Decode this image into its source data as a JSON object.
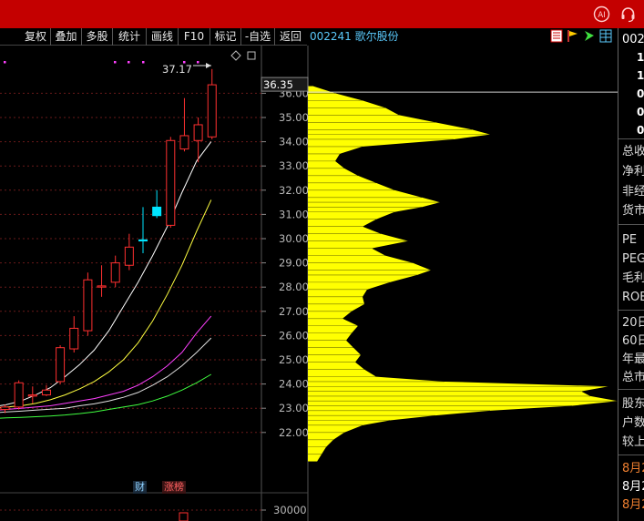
{
  "titlebar": {
    "icons": [
      "ai-assistant-icon",
      "customer-service-icon"
    ],
    "ai_label": "AI"
  },
  "toolbar": {
    "buttons": [
      {
        "label": "复权"
      },
      {
        "label": "叠加"
      },
      {
        "label": "多股"
      },
      {
        "label": "统计"
      },
      {
        "label": "画线"
      },
      {
        "label": "F10"
      },
      {
        "label": "标记"
      },
      {
        "label": "-自选"
      },
      {
        "label": "返回"
      }
    ]
  },
  "stock": {
    "code_name": "002241 歌尔股份"
  },
  "chart": {
    "current_price": "36.35",
    "high_label": "37.17",
    "badges": {
      "finance": "财",
      "limit_list": "涨榜"
    },
    "volume_label": "30000",
    "colors": {
      "up": "#ff3030",
      "flat": "#00e5ff",
      "ma5": "#ffffff",
      "ma10": "#ffff40",
      "ma20": "#ff40ff",
      "ma30": "#e0e0e0",
      "ma60": "#40ff40",
      "chip": "#ffff00"
    }
  },
  "chart_data": {
    "type": "candlestick",
    "y_axis": {
      "ticks": [
        "36.00",
        "35.00",
        "34.00",
        "33.00",
        "32.00",
        "31.00",
        "30.00",
        "29.00",
        "28.00",
        "27.00",
        "26.00",
        "25.00",
        "24.00",
        "23.00",
        "22.00"
      ],
      "range": [
        21.8,
        36.9
      ]
    },
    "candles": [
      {
        "o": 22.95,
        "c": 23.05,
        "h": 23.15,
        "l": 22.8
      },
      {
        "o": 23.05,
        "c": 24.05,
        "h": 24.15,
        "l": 22.95
      },
      {
        "o": 23.5,
        "c": 23.55,
        "h": 23.9,
        "l": 23.2
      },
      {
        "o": 23.55,
        "c": 23.75,
        "h": 23.95,
        "l": 23.5
      },
      {
        "o": 24.1,
        "c": 25.5,
        "h": 25.6,
        "l": 24.0
      },
      {
        "o": 25.45,
        "c": 26.3,
        "h": 26.8,
        "l": 25.3
      },
      {
        "o": 26.2,
        "c": 28.3,
        "h": 28.6,
        "l": 26.0
      },
      {
        "o": 28.0,
        "c": 28.05,
        "h": 28.9,
        "l": 27.6
      },
      {
        "o": 28.2,
        "c": 29.0,
        "h": 29.3,
        "l": 28.0
      },
      {
        "o": 28.9,
        "c": 29.65,
        "h": 30.2,
        "l": 28.7
      },
      {
        "o": 29.95,
        "c": 29.95,
        "h": 31.3,
        "l": 29.4
      },
      {
        "o": 31.3,
        "c": 30.95,
        "h": 32.0,
        "l": 30.85
      },
      {
        "o": 30.55,
        "c": 34.05,
        "h": 34.2,
        "l": 30.45
      },
      {
        "o": 33.7,
        "c": 34.25,
        "h": 35.8,
        "l": 33.6
      },
      {
        "o": 34.05,
        "c": 34.7,
        "h": 35.0,
        "l": 33.15
      },
      {
        "o": 34.2,
        "c": 36.35,
        "h": 37.0,
        "l": 34.1
      }
    ],
    "ma_lines": [
      {
        "name": "MA5",
        "values": [
          23.0,
          23.05,
          23.15,
          23.3,
          23.55,
          23.85,
          24.3,
          24.8,
          25.4,
          26.2,
          27.2,
          28.2,
          29.3,
          30.5,
          31.9,
          33.2,
          34.0
        ]
      },
      {
        "name": "MA10",
        "values": [
          22.95,
          23.0,
          23.05,
          23.1,
          23.2,
          23.35,
          23.55,
          23.8,
          24.1,
          24.5,
          25.0,
          25.7,
          26.6,
          27.7,
          28.9,
          30.3,
          31.6
        ]
      },
      {
        "name": "MA20",
        "values": [
          22.85,
          22.9,
          22.95,
          23.0,
          23.05,
          23.1,
          23.2,
          23.3,
          23.4,
          23.55,
          23.7,
          23.95,
          24.3,
          24.75,
          25.3,
          26.1,
          26.8
        ]
      },
      {
        "name": "MA30",
        "values": [
          22.75,
          22.8,
          22.85,
          22.88,
          22.92,
          22.96,
          23.0,
          23.1,
          23.18,
          23.3,
          23.45,
          23.65,
          23.95,
          24.3,
          24.75,
          25.3,
          25.9
        ]
      },
      {
        "name": "MA60",
        "values": [
          22.55,
          22.58,
          22.6,
          22.62,
          22.65,
          22.68,
          22.72,
          22.78,
          22.85,
          22.95,
          23.05,
          23.15,
          23.3,
          23.5,
          23.75,
          24.05,
          24.4
        ]
      }
    ],
    "chip_distribution": [
      [
        36.3,
        5
      ],
      [
        36.0,
        30
      ],
      [
        35.7,
        60
      ],
      [
        35.4,
        85
      ],
      [
        35.1,
        100
      ],
      [
        34.8,
        140
      ],
      [
        34.5,
        180
      ],
      [
        34.3,
        200
      ],
      [
        34.1,
        160
      ],
      [
        33.8,
        60
      ],
      [
        33.5,
        35
      ],
      [
        33.2,
        30
      ],
      [
        32.9,
        40
      ],
      [
        32.6,
        55
      ],
      [
        32.3,
        75
      ],
      [
        32.0,
        95
      ],
      [
        31.7,
        125
      ],
      [
        31.5,
        145
      ],
      [
        31.3,
        125
      ],
      [
        31.1,
        95
      ],
      [
        30.8,
        75
      ],
      [
        30.5,
        60
      ],
      [
        30.2,
        80
      ],
      [
        29.9,
        110
      ],
      [
        29.6,
        70
      ],
      [
        29.3,
        85
      ],
      [
        29.0,
        115
      ],
      [
        28.7,
        135
      ],
      [
        28.5,
        120
      ],
      [
        28.2,
        90
      ],
      [
        27.9,
        65
      ],
      [
        27.6,
        60
      ],
      [
        27.3,
        62
      ],
      [
        27.0,
        48
      ],
      [
        26.7,
        38
      ],
      [
        26.4,
        55
      ],
      [
        26.1,
        48
      ],
      [
        25.8,
        42
      ],
      [
        25.5,
        50
      ],
      [
        25.2,
        58
      ],
      [
        24.9,
        52
      ],
      [
        24.6,
        62
      ],
      [
        24.3,
        75
      ],
      [
        24.1,
        150
      ],
      [
        23.9,
        330
      ],
      [
        23.7,
        300
      ],
      [
        23.5,
        310
      ],
      [
        23.3,
        340
      ],
      [
        23.1,
        290
      ],
      [
        22.9,
        200
      ],
      [
        22.7,
        140
      ],
      [
        22.5,
        90
      ],
      [
        22.3,
        60
      ],
      [
        22.0,
        40
      ],
      [
        21.7,
        28
      ],
      [
        21.4,
        20
      ],
      [
        21.1,
        15
      ],
      [
        20.8,
        10
      ]
    ]
  },
  "right_panel": {
    "code_partial": "002",
    "values": [
      "1.",
      "1.",
      "0.",
      "0.",
      "0."
    ],
    "labels_a": [
      "总收",
      "净利",
      "非经",
      "货市"
    ],
    "labels_b": [
      "PE",
      "PEG",
      "毛利",
      "ROE"
    ],
    "labels_c": [
      "20日",
      "60日",
      "年最",
      "总市"
    ],
    "labels_d": [
      "股东",
      "户数",
      "较上"
    ],
    "dates": [
      "8月2",
      "8月2",
      "8月2"
    ]
  }
}
